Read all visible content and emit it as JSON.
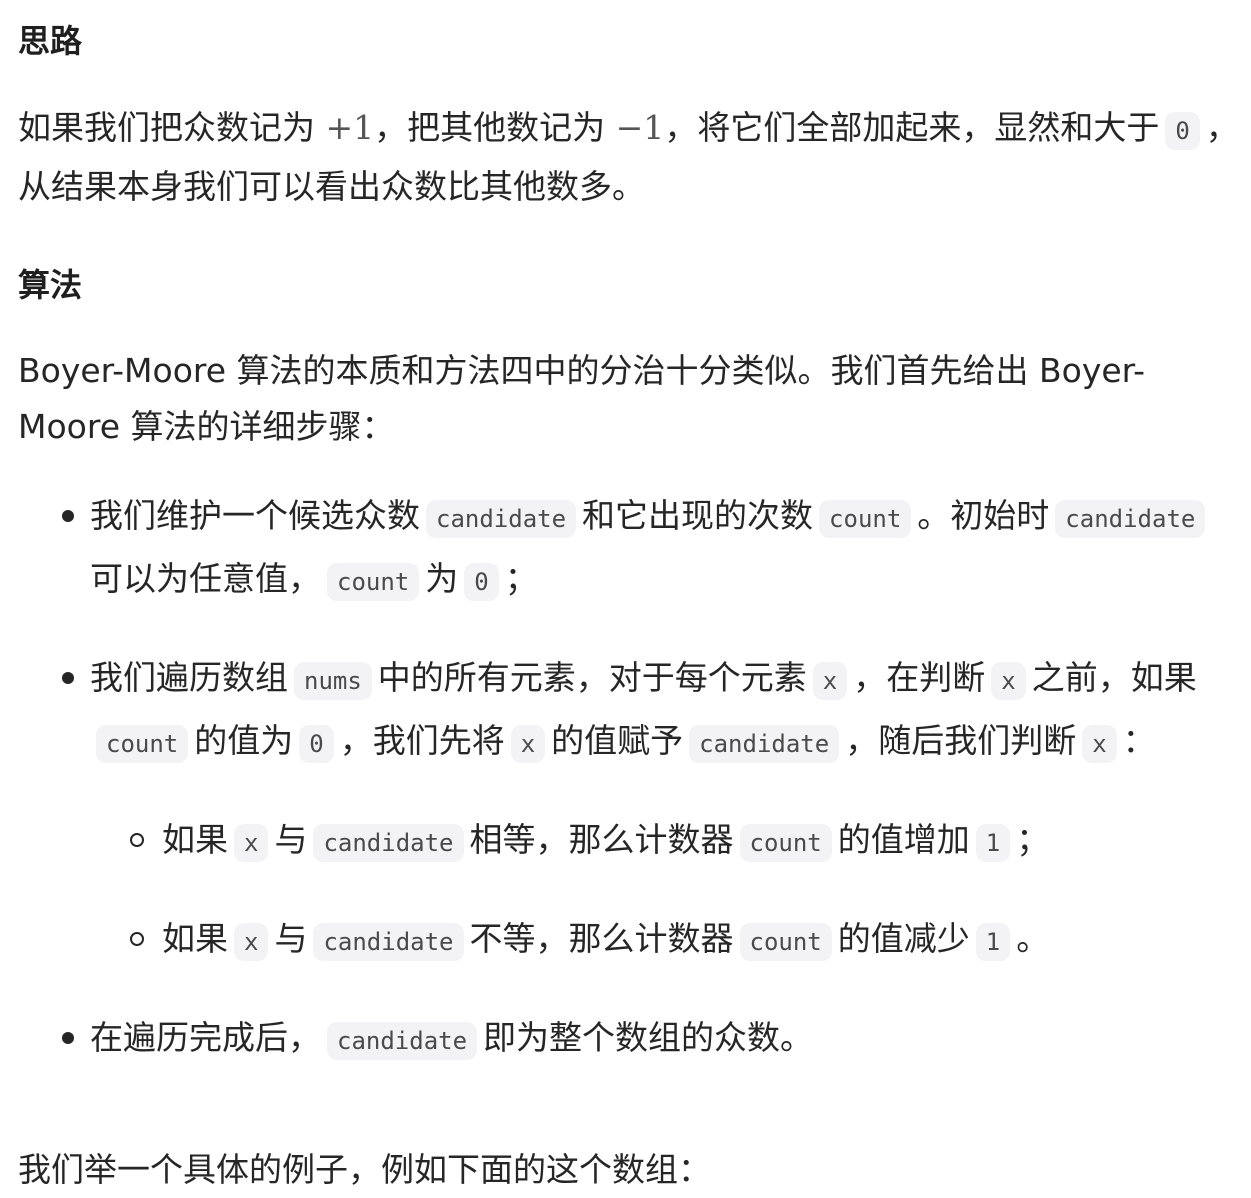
{
  "section1": {
    "heading": "思路",
    "p_part1": "如果我们把众数记为 ",
    "math_plus": "+1",
    "p_part2": "，把其他数记为 ",
    "math_minus": "−1",
    "p_part3": "，将它们全部加起来，显然和大于",
    "code_zero": "0",
    "p_part4": "，从结果本身我们可以看出众数比其他数多。"
  },
  "section2": {
    "heading": "算法",
    "intro": "Boyer-Moore 算法的本质和方法四中的分治十分类似。我们首先给出 Boyer-Moore 算法的详细步骤："
  },
  "list": {
    "item1": {
      "t1": "我们维护一个候选众数",
      "c1": "candidate",
      "t2": "和它出现的次数",
      "c2": "count",
      "t3": "。初始时",
      "c3": "candidate",
      "t4": "可以为任意值，",
      "c4": "count",
      "t5": "为",
      "c5": "0",
      "t6": "；"
    },
    "item2": {
      "t1": "我们遍历数组",
      "c1": "nums",
      "t2": "中的所有元素，对于每个元素",
      "c2": "x",
      "t3": "，在判断",
      "c3": "x",
      "t4": "之前，如果",
      "c4": "count",
      "t5": "的值为",
      "c5": "0",
      "t6": "，我们先将",
      "c6": "x",
      "t7": "的值赋予",
      "c7": "candidate",
      "t8": "，随后我们判断",
      "c8": "x",
      "t9": "："
    },
    "sub1": {
      "t1": "如果",
      "c1": "x",
      "t2": "与",
      "c2": "candidate",
      "t3": "相等，那么计数器",
      "c3": "count",
      "t4": "的值增加",
      "c4": "1",
      "t5": "；"
    },
    "sub2": {
      "t1": "如果",
      "c1": "x",
      "t2": "与",
      "c2": "candidate",
      "t3": "不等，那么计数器",
      "c3": "count",
      "t4": "的值减少",
      "c4": "1",
      "t5": "。"
    },
    "item3": {
      "t1": "在遍历完成后，",
      "c1": "candidate",
      "t2": "即为整个数组的众数。"
    }
  },
  "footer": {
    "text": "我们举一个具体的例子，例如下面的这个数组："
  }
}
